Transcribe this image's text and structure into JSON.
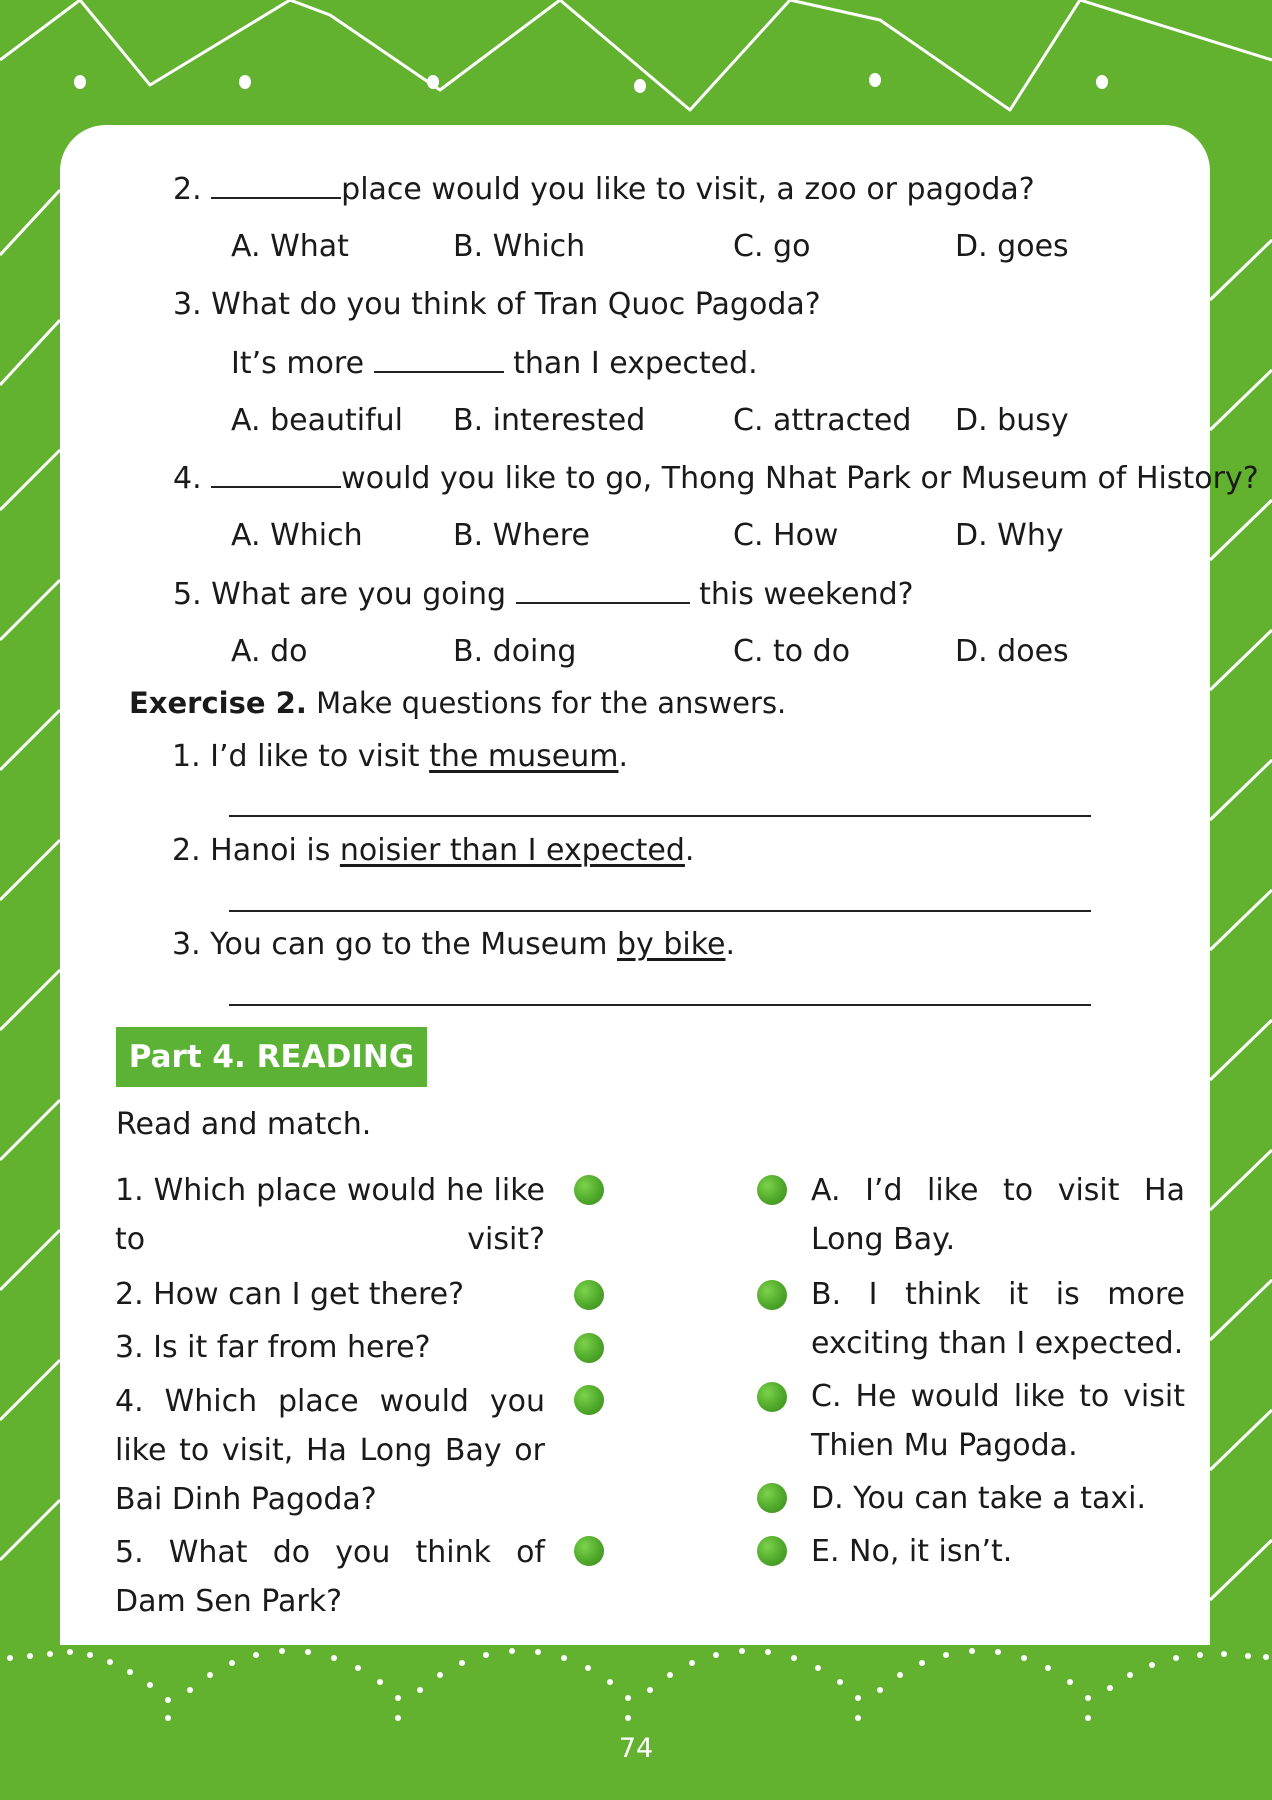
{
  "exercise1": {
    "questions": [
      {
        "number": "2.",
        "blank_before": true,
        "text": "place would you like to visit, a zoo or pagoda?",
        "options": [
          "A. What",
          "B. Which",
          "C. go",
          "D. goes"
        ]
      },
      {
        "number": "3.",
        "text": "What do you think of Tran Quoc Pagoda?",
        "line2_before": "It’s more",
        "line2_after": "than I expected.",
        "options": [
          "A. beautiful",
          "B. interested",
          "C. attracted",
          "D. busy"
        ]
      },
      {
        "number": "4.",
        "blank_before": true,
        "text": "would you like to go, Thong Nhat Park or Museum of History?",
        "options": [
          "A. Which",
          "B. Where",
          "C. How",
          "D. Why"
        ]
      },
      {
        "number": "5.",
        "text_before": "What are you going",
        "text_after": "this weekend?",
        "options": [
          "A. do",
          "B. doing",
          "C. to do",
          "D. does"
        ]
      }
    ]
  },
  "exercise2": {
    "label": "Exercise 2.",
    "instruction": "Make questions for the answers.",
    "items": [
      {
        "number": "1.",
        "before": "I’d like to visit",
        "underlined": "the museum",
        "after": "."
      },
      {
        "number": "2.",
        "before": "Hanoi is",
        "underlined": "noisier than I expected",
        "after": "."
      },
      {
        "number": "3.",
        "before": "You can go to the Museum",
        "underlined": "by bike",
        "after": "."
      }
    ]
  },
  "part4": {
    "title": "Part 4. READING",
    "instruction": "Read and match.",
    "left": [
      "1.  Which place would he like to visit?",
      "2.  How can I get there?",
      "3.  Is it far from here?",
      "4.  Which place would you like to visit, Ha Long Bay or Bai Dinh Pagoda?",
      "5.  What do you think of Dam Sen Park?"
    ],
    "right": [
      "A.  I’d like to visit Ha Long Bay.",
      "B. I think it is more exciting than I expected.",
      "C.  He would like to visit Thien Mu Pagoda.",
      "D. You can take a taxi.",
      "E. No, it isn’t."
    ]
  },
  "page_number": "74",
  "colors": {
    "frame_green": "#62b22f",
    "banner_green": "#5bb234",
    "dot_green": "#4fa82a",
    "card_white": "#ffffff"
  }
}
